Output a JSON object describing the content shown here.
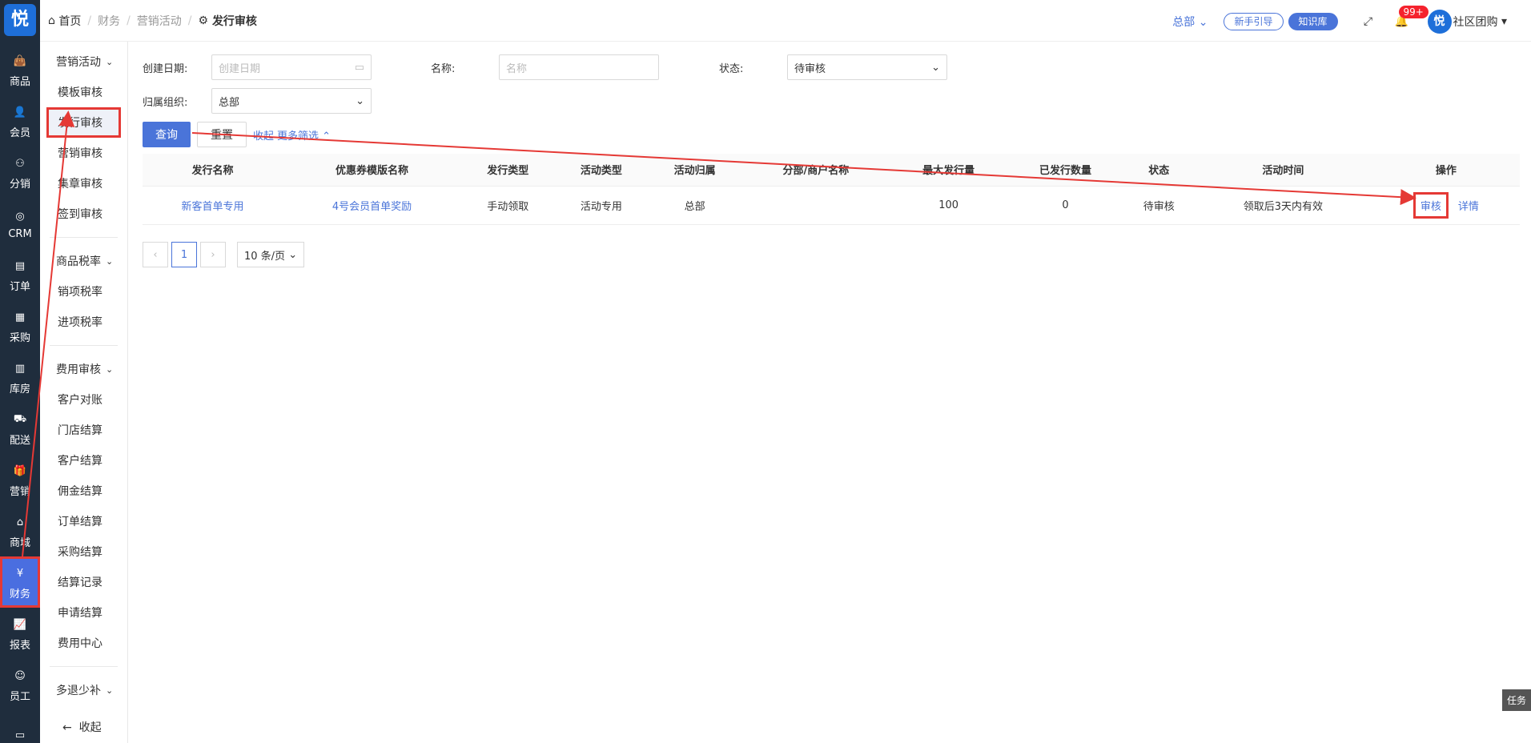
{
  "logo": "悦",
  "rail": [
    {
      "label": "商品",
      "icon": "bag-icon"
    },
    {
      "label": "会员",
      "icon": "user-icon"
    },
    {
      "label": "分销",
      "icon": "network-icon"
    },
    {
      "label": "CRM",
      "icon": "crm-icon"
    },
    {
      "label": "订单",
      "icon": "order-icon"
    },
    {
      "label": "采购",
      "icon": "clipboard-icon"
    },
    {
      "label": "库房",
      "icon": "warehouse-icon"
    },
    {
      "label": "配送",
      "icon": "truck-icon"
    },
    {
      "label": "营销",
      "icon": "gift-icon"
    },
    {
      "label": "商城",
      "icon": "home-icon"
    },
    {
      "label": "财务",
      "icon": "yen-icon",
      "active": true
    },
    {
      "label": "报表",
      "icon": "chart-icon"
    },
    {
      "label": "员工",
      "icon": "staff-icon"
    },
    {
      "label": "",
      "icon": "shop-icon"
    }
  ],
  "submenu": {
    "groups": [
      {
        "title": "营销活动",
        "items": [
          "模板审核",
          "发行审核",
          "营销审核",
          "集章审核",
          "签到审核"
        ],
        "active": "发行审核"
      },
      {
        "title": "商品税率",
        "items": [
          "销项税率",
          "进项税率"
        ]
      },
      {
        "title": "费用审核",
        "items": [
          "客户对账",
          "门店结算",
          "客户结算",
          "佣金结算",
          "订单结算",
          "采购结算",
          "结算记录",
          "申请结算",
          "费用中心"
        ]
      },
      {
        "title": "多退少补",
        "items": []
      }
    ],
    "collapse": "收起"
  },
  "breadcrumb": {
    "home": "首页",
    "l1": "财务",
    "l2": "营销活动",
    "current": "发行审核"
  },
  "header": {
    "org": "总部",
    "guide": "新手引导",
    "kb": "知识库",
    "badge": "99+",
    "user": "社区团购",
    "avatar": "悦"
  },
  "filters": {
    "created_label": "创建日期:",
    "created_placeholder": "创建日期",
    "name_label": "名称:",
    "name_placeholder": "名称",
    "status_label": "状态:",
    "status_value": "待审核",
    "org_label": "归属组织:",
    "org_value": "总部",
    "query": "查询",
    "reset": "重置",
    "collapse": "收起",
    "more": "更多筛选"
  },
  "table": {
    "headers": [
      "发行名称",
      "优惠券模版名称",
      "发行类型",
      "活动类型",
      "活动归属",
      "分部/商户名称",
      "最大发行量",
      "已发行数量",
      "状态",
      "活动时间",
      "操作"
    ],
    "rows": [
      {
        "name": "新客首单专用",
        "template": "4号会员首单奖励",
        "issue_type": "手动领取",
        "act_type": "活动专用",
        "owner": "总部",
        "branch": "",
        "max": "100",
        "issued": "0",
        "status": "待审核",
        "time": "领取后3天内有效",
        "audit": "审核",
        "detail": "详情"
      }
    ]
  },
  "pager": {
    "prev": "‹",
    "page": "1",
    "next": "›",
    "size": "10 条/页"
  },
  "task": "任务"
}
